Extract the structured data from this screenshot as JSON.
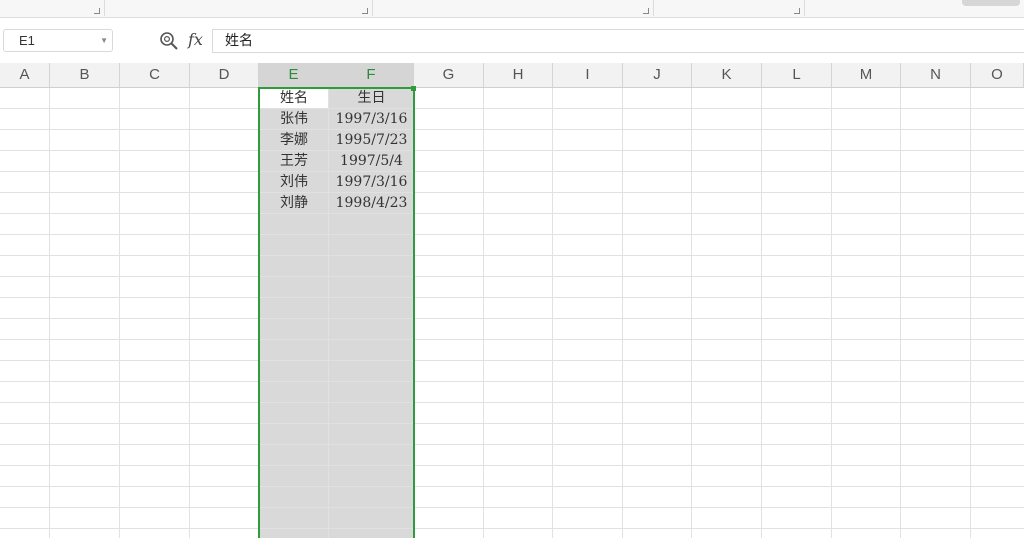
{
  "formula_bar": {
    "name_box": "E1",
    "formula_value": "姓名",
    "fx_label": "fx"
  },
  "columns": [
    "A",
    "B",
    "C",
    "D",
    "E",
    "F",
    "G",
    "H",
    "I",
    "J",
    "K",
    "L",
    "M",
    "N",
    "O"
  ],
  "selected_columns": [
    "E",
    "F"
  ],
  "active_cell": "E1",
  "table": {
    "headers": [
      "姓名",
      "生日"
    ],
    "rows": [
      [
        "张伟",
        "1997/3/16"
      ],
      [
        "李娜",
        "1995/7/23"
      ],
      [
        "王芳",
        "1997/5/4"
      ],
      [
        "刘伟",
        "1997/3/16"
      ],
      [
        "刘静",
        "1998/4/23"
      ]
    ]
  },
  "colors": {
    "selection_border": "#2e9b3c",
    "selection_fill": "#d9d9d9",
    "selected_header_text": "#2e8b3c"
  }
}
